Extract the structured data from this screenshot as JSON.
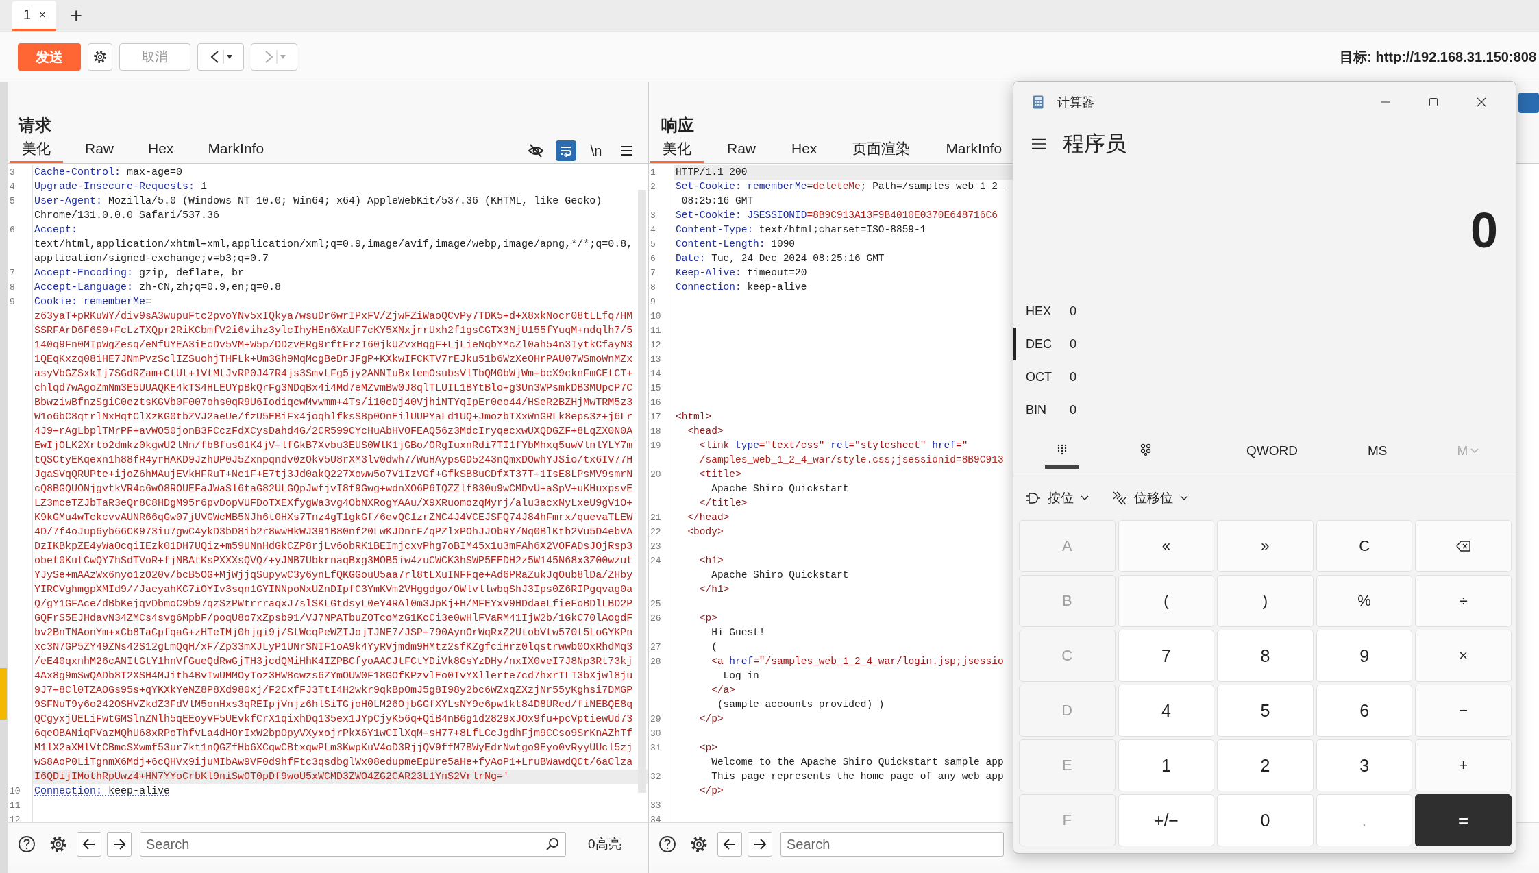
{
  "tabs": [
    {
      "label": "1",
      "close": "×",
      "selected": true
    }
  ],
  "new_tab": "+",
  "toolbar": {
    "send": "发送",
    "cancel": "取消",
    "cancel_disabled": true,
    "back_disabled": false,
    "forward_disabled": true
  },
  "target": {
    "label": "目标:",
    "url": "http://192.168.31.150:808"
  },
  "request": {
    "title": "请求",
    "tabs": [
      {
        "label": "美化",
        "selected": true
      },
      {
        "label": "Raw",
        "selected": false
      },
      {
        "label": "Hex",
        "selected": false
      },
      {
        "label": "MarkInfo",
        "selected": false
      }
    ],
    "tools": [
      {
        "kind": "hide",
        "selected": false
      },
      {
        "kind": "wrap",
        "selected": true
      },
      {
        "kind": "newline",
        "label": "\\n",
        "selected": false
      },
      {
        "kind": "menu",
        "selected": false
      }
    ],
    "lines": [
      {
        "number": "3",
        "current": false,
        "rows": [
          [
            {
              "kind": "key",
              "text": "Cache-Control:"
            },
            {
              "kind": "plain",
              "text": " max-age=0"
            }
          ]
        ]
      },
      {
        "number": "4",
        "current": false,
        "rows": [
          [
            {
              "kind": "key",
              "text": "Upgrade-Insecure-Requests:"
            },
            {
              "kind": "plain",
              "text": " 1"
            }
          ]
        ]
      },
      {
        "number": "5",
        "current": false,
        "rows": [
          [
            {
              "kind": "key",
              "text": "User-Agent:"
            },
            {
              "kind": "plain",
              "text": " Mozilla/5.0 (Windows NT 10.0; Win64; x64) AppleWebKit/537.36 (KHTML, like Gecko)"
            }
          ],
          [
            {
              "kind": "plain",
              "text": "Chrome/131.0.0.0 Safari/537.36"
            }
          ]
        ]
      },
      {
        "number": "6",
        "current": false,
        "rows": [
          [
            {
              "kind": "key",
              "text": "Accept:"
            }
          ],
          [
            {
              "kind": "plain",
              "text": "text/html,application/xhtml+xml,application/xml;q=0.9,image/avif,image/webp,image/apng,*/*;q=0.8,"
            }
          ],
          [
            {
              "kind": "plain",
              "text": "application/signed-exchange;v=b3;q=0.7"
            }
          ]
        ]
      },
      {
        "number": "7",
        "current": false,
        "rows": [
          [
            {
              "kind": "key",
              "text": "Accept-Encoding:"
            },
            {
              "kind": "plain",
              "text": " gzip, deflate, br"
            }
          ]
        ]
      },
      {
        "number": "8",
        "current": false,
        "rows": [
          [
            {
              "kind": "key",
              "text": "Accept-Language:"
            },
            {
              "kind": "plain",
              "text": " zh-CN,zh;q=0.9,en;q=0.8"
            }
          ]
        ]
      },
      {
        "number": "9",
        "current": true,
        "rows": [
          [
            {
              "kind": "key",
              "text": "Cookie:"
            },
            {
              "kind": "attr",
              "text": " rememberMe"
            },
            {
              "kind": "plain",
              "text": "="
            }
          ],
          [
            {
              "kind": "value",
              "text": "z63yaT+pRKuWY/div9sA3wupuFtc2pvoYNv5xIQkya7wsuDr6wrIPxFV/ZjwFZiWaoQCvPy7TDK5+d+X8xkNocr08tLLfq7HM"
            }
          ],
          [
            {
              "kind": "value",
              "text": "SSRFArD6F6S0+FcLzTXQpr2RiKCbmfV2i6vihz3ylcIhyHEn6XaUF7cKY5XNxjrrUxh2f1gsCGTX3NjU155fYuqM+ndqlh7/5"
            }
          ],
          [
            {
              "kind": "value",
              "text": "140q9Fn0MIpWgZesq/eNfUYEA3iEcDv5VM+W5p/DDzvERg9rftFrzI60jkUZvxHqgF+LjLieNqbYMcZl0ah54n3IytkCfayN3"
            }
          ],
          [
            {
              "kind": "value",
              "text": "1QEqKxzq08iHE7JNmPvzSclIZSuohjTHFLk+Um3Gh9MqMcgBeDrJFgP+KXkwIFCKTV7rEJku51b6WzXeOHrPAU07WSmoWnMZx"
            }
          ],
          [
            {
              "kind": "value",
              "text": "asyVbGZSxkIj7SGdRZam+CtUt+1VtMtJvRP0J47R4js3SmvLFg5jy2ANNIuBxlemOsubsVlTbQM0bWjWm+bcX9cknFmCEtCT+"
            }
          ],
          [
            {
              "kind": "value",
              "text": "chlqd7wAgoZmNm3E5UUAQKE4kTS4HLEUYpBkQrFg3NDqBx4i4Md7eMZvmBw0J8qlTLUIL1BYtBlo+g3Un3WPsmkDB3MUpcP7C"
            }
          ],
          [
            {
              "kind": "value",
              "text": "BbwziwBfnzSgiC0eztsKGVb0F007ohs0qR9U6IodiqcwMvwmm+4Ts/i10cDj40VjhiNTYqIpEr0eo44/HSeR2BZHjMwTRM5z3"
            }
          ],
          [
            {
              "kind": "value",
              "text": "W1o6bC8qtrlNxHqtClXzKG0tbZVJ2aeUe/fzU5EBiFx4joqhlfksS8p0OnEilUUPYaLd1UQ+JmozbIXxWnGRLk8eps3z+j6Lr"
            }
          ],
          [
            {
              "kind": "value",
              "text": "4J9+rAgLbplTMrPF+avWO50jonB3FCczFdXCysDahd4G/2CR599CYcHuAbHVOFEAQ56z3MdcIryqecxwUXQDGZF+8LqZX0N0A"
            }
          ],
          [
            {
              "kind": "value",
              "text": "EwIjOLK2Xrto2dmkz0kgwU2lNn/fb8fus01K4jV+lfGkB7Xvbu3EUS0WlK1jGBo/ORgIuxnRdi7TI1fYbMhxq5uwVlnlYLY7m"
            }
          ],
          [
            {
              "kind": "value",
              "text": "tQSCtyEKqexn1h88fR4yrHAKD9JzhUP0J5Zxnpqndv0zOkV5U8rXM3lv0dwh7/WuHAypsGD5243nQmxDOwhYJSio/tx6IV77H"
            }
          ],
          [
            {
              "kind": "value",
              "text": "JgaSVqQRUPte+ijoZ6hMAujEVkHFRuT+Nc1F+E7tj3Jd0akQ227Xoww5o7V1IzVGf+GfkSB8uCDfXT37T+1IsE8LPsMV9smrN"
            }
          ],
          [
            {
              "kind": "value",
              "text": "cQ8BGQUONjgvtkVR4c6wO8ROUEFaJWaSl6taG82ULGQpJwfjvI8f9Gwg+wdnXO6P6IQZZlf830u9wCMDvU+aSpV+uKHuxpsvE"
            }
          ],
          [
            {
              "kind": "value",
              "text": "LZ3mceTZJbTaR3eQr8C8HDgM95r6pvDopVUFDoTXEXfygWa3vg4ObNXRogYAAu/X9XRuomozqMyrj/alu3acxNyLxeU9gV1O+"
            }
          ],
          [
            {
              "kind": "value",
              "text": "K9kGMu4wTckcvvAUNR66qGw07jUVGWcMB5NJh6t0HXs7Tnz4gT1gkGf/6evQC1zrZNC4J4VCEJSFQ74J84hFmrx/quevaTLEW"
            }
          ],
          [
            {
              "kind": "value",
              "text": "4D/7f4oJup6yb66CK973iu7gwC4ykD3bD8ib2r8wwHkWJ391B80nf20LwKJDnrF/qPZlxPOhJJObRY/Nq0BlKtb2Vu5D4ebVA"
            }
          ],
          [
            {
              "kind": "value",
              "text": "DzIKBkpZE4yWaOcqiIEzk01DH7UQiz+m59UNnHdGkCZP8rjLv6obRK1BEImjcxvPhg7oBIM45x1u3mFAh6X2VOFADsJOjRsp3"
            }
          ],
          [
            {
              "kind": "value",
              "text": "obet0KutCwQY7hSdTVoR+fjNBAtKsPXXXsQVQ/+yJNB7UbkrnaqBxg3MOB5iw4zuCWCK3hSWP5EEDH2z5W145N68x3Z00wzut"
            }
          ],
          [
            {
              "kind": "value",
              "text": "YJySe+mAAzWx6nyo1zO20v/bcB5OG+MjWjjqSupywC3y6ynLfQKGGouU5aa7rl8tLXuINFFqe+Ad6PRaZukJqOub8lDa/ZHby"
            }
          ],
          [
            {
              "kind": "value",
              "text": "YIRCVghmgpXMId9//JaeyahKC7iOYIv3sqn1GYINNpoNxUZnDIpfC3YmKVm2VHggdgo/OWlvllwbqShJ3Ips0Z6RIPgqvag0a"
            }
          ],
          [
            {
              "kind": "value",
              "text": "Q/gY1GFAce/dBbKejqvDbmoC9b97qzSzPWtrrraqxJ7slSKLGtdsyL0eY4RAl0m3JpKj+H/MFEYxV9HDdaeLfieFoBDlLBD2P"
            }
          ],
          [
            {
              "kind": "value",
              "text": "GQFrS5EJHdavN34ZMCs4svg6MpbF/poqU8o7xZpsb91/VJ7NPATbuZOTcoMzG1KcCi3e0wHlFVaRM41IjW2b/1GkC70lAogdF"
            }
          ],
          [
            {
              "kind": "value",
              "text": "bv2BnTNAonYm+xCb8TaCpfqaG+zHTeIMj0hjgi9j/StWcqPeWZIJojTJNE7/JSP+790AynOrWqRxZ2UtobVtw570t5LoGYKPn"
            }
          ],
          [
            {
              "kind": "value",
              "text": "xc3N7GP5ZY49ZNs42S12gLmQqH/xF/Zp33mXJLyP1UNrSNIF1oA9k4YyRVjmdm9HMtz2sfKZgfciHrz0lqstrwwb0OxRhdMq3"
            }
          ],
          [
            {
              "kind": "value",
              "text": "/eE40qxnhM26cANItGtY1hnVfGueQdRwGjTH3jcdQMiHhK4IZPBCfyoAACJtFCtYDiVk8GsYzDHy/nxIX0veI7J8Np3Rt73kj"
            }
          ],
          [
            {
              "kind": "value",
              "text": "4Ax8g9mSwQADb8T2XSH4MJith4BvIwUMMOyToz3HW8cwzs6ZYmOUW0F18GOfKPzvlEo0IvYXllerte7cd7hxrTLI3bXjwl8ju"
            }
          ],
          [
            {
              "kind": "value",
              "text": "9J7+8Cl0TZAOGs95s+qYKXkYeNZ8P8Xd980xj/F2CxfFJ3TtI4H2wkr9qkBpOmJ5g8I98y2bc6WZxqZXzjNr55yKghsi7DMGP"
            }
          ],
          [
            {
              "kind": "value",
              "text": "9SFNuT9y6o242OSHVZkdZ3FdVlM5onHxs3qREIpjVnjz6hlSiTGjoH0LM26OjbGGfXYLsNY9e6pw1kt84D8URed/fiNEBQE8q"
            }
          ],
          [
            {
              "kind": "value",
              "text": "QCgyxjUELiFwtGMSlnZNlh5qEEoyVF5UEvkfCrX1qixhDq135ex1JYpCjyK56q+QiB4nB6g1d2829xJOx9fu+pcVptiewUd73"
            }
          ],
          [
            {
              "kind": "value",
              "text": "6qeOBANiqPVazMQhU68xRPoThfvLa4dHOrIxW2bpOpyVXyxojrPkX6Y1wCIlXqM+sH77+8LfLCcJgdhFjm9CCso9SrKnAZhTf"
            }
          ],
          [
            {
              "kind": "value",
              "text": "M1lX2aXMlVtCBmcSXwmf53ur7kt1nQGZfHb6XCqwCBtxqwPLm3KwpKuV4oD3RjjQV9ffM7BWyEdrNwtgo9Eyo0vRyyUUcl5zj"
            }
          ],
          [
            {
              "kind": "value",
              "text": "wS8AoP0LiTgnmX6Mdj+6cQHVx9ijuMIbAw9VF0d9hfFtc3qsdbglWx08edupmeEpUre5aHe+fyAoP1+LruBWawdQCt/6aClza"
            }
          ],
          [
            {
              "kind": "value",
              "text": "I6QDijIMothRpUwz4+HN7YYoCrbKl9niSwOT0pDf9woU5xWCMD3ZWO4ZG2CAR23L1YnS2VrlrNg='"
            }
          ]
        ]
      },
      {
        "number": "10",
        "current": false,
        "rows": [
          [
            {
              "kind": "key_flagged",
              "text": "Connection:"
            },
            {
              "kind": "plain_flagged",
              "text": " keep-alive"
            }
          ]
        ]
      },
      {
        "number": "11",
        "current": false
      },
      {
        "number": "12",
        "current": false
      }
    ],
    "search": {
      "placeholder": "Search"
    },
    "highlights": "0高亮"
  },
  "response": {
    "title": "响应",
    "tabs": [
      {
        "label": "美化",
        "selected": true
      },
      {
        "label": "Raw",
        "selected": false
      },
      {
        "label": "Hex",
        "selected": false
      },
      {
        "label": "页面渲染",
        "selected": false
      },
      {
        "label": "MarkInfo",
        "selected": false
      }
    ],
    "lines": [
      {
        "number": "1",
        "current": true,
        "rows": [
          [
            {
              "kind": "plain",
              "text": "HTTP/1.1 200"
            }
          ]
        ]
      },
      {
        "number": "2",
        "current": false,
        "rows": [
          [
            {
              "kind": "key",
              "text": "Set-Cookie:"
            },
            {
              "kind": "attr",
              "text": " rememberMe"
            },
            {
              "kind": "plain",
              "text": "="
            },
            {
              "kind": "value",
              "text": "deleteMe"
            },
            {
              "kind": "plain",
              "text": "; Path=/samples_web_1_2_"
            }
          ],
          [
            {
              "kind": "plain",
              "text": " 08:25:16 GMT"
            }
          ]
        ]
      },
      {
        "number": "3",
        "current": false,
        "rows": [
          [
            {
              "kind": "key",
              "text": "Set-Cookie:"
            },
            {
              "kind": "attr",
              "text": " JSESSIONID"
            },
            {
              "kind": "value",
              "text": "=8B9C913A13F9B4010E0370E648716C6"
            }
          ]
        ]
      },
      {
        "number": "4",
        "current": false,
        "rows": [
          [
            {
              "kind": "key",
              "text": "Content-Type:"
            },
            {
              "kind": "plain",
              "text": " text/html;charset=ISO-8859-1"
            }
          ]
        ]
      },
      {
        "number": "5",
        "current": false,
        "rows": [
          [
            {
              "kind": "key",
              "text": "Content-Length:"
            },
            {
              "kind": "plain",
              "text": " 1090"
            }
          ]
        ]
      },
      {
        "number": "6",
        "current": false,
        "rows": [
          [
            {
              "kind": "key",
              "text": "Date:"
            },
            {
              "kind": "plain",
              "text": " Tue, 24 Dec 2024 08:25:16 GMT"
            }
          ]
        ]
      },
      {
        "number": "7",
        "current": false,
        "rows": [
          [
            {
              "kind": "key",
              "text": "Keep-Alive:"
            },
            {
              "kind": "plain",
              "text": " timeout=20"
            }
          ]
        ]
      },
      {
        "number": "8",
        "current": false,
        "rows": [
          [
            {
              "kind": "key",
              "text": "Connection:"
            },
            {
              "kind": "plain",
              "text": " keep-alive"
            }
          ]
        ]
      },
      {
        "number": "9",
        "current": false
      },
      {
        "number": "10",
        "current": false
      },
      {
        "number": "11",
        "current": false
      },
      {
        "number": "12",
        "current": false
      },
      {
        "number": "13",
        "current": false
      },
      {
        "number": "14",
        "current": false
      },
      {
        "number": "15",
        "current": false
      },
      {
        "number": "16",
        "current": false
      },
      {
        "number": "17",
        "current": false,
        "rows": [
          [
            {
              "kind": "tag",
              "text": "<html>"
            }
          ]
        ]
      },
      {
        "number": "18",
        "current": false,
        "rows": [
          [
            {
              "kind": "tag",
              "text": "  <head>"
            }
          ]
        ]
      },
      {
        "number": "19",
        "current": false,
        "rows": [
          [
            {
              "kind": "tag",
              "text": "    <link"
            },
            {
              "kind": "attr",
              "text": " type"
            },
            {
              "kind": "str",
              "text": "=\"text/css\""
            },
            {
              "kind": "attr",
              "text": " rel"
            },
            {
              "kind": "str",
              "text": "=\"stylesheet\""
            },
            {
              "kind": "attr",
              "text": " href"
            },
            {
              "kind": "str",
              "text": "=\""
            }
          ],
          [
            {
              "kind": "value",
              "text": "    /samples_web_1_2_4_war/style.css;jsessionid=8B9C913"
            }
          ]
        ]
      },
      {
        "number": "20",
        "current": false,
        "rows": [
          [
            {
              "kind": "tag",
              "text": "    <title>"
            }
          ],
          [
            {
              "kind": "plain",
              "text": "      Apache Shiro Quickstart"
            }
          ],
          [
            {
              "kind": "tag",
              "text": "    </title>"
            }
          ]
        ]
      },
      {
        "number": "21",
        "current": false,
        "rows": [
          [
            {
              "kind": "tag",
              "text": "  </head>"
            }
          ]
        ]
      },
      {
        "number": "22",
        "current": false,
        "rows": [
          [
            {
              "kind": "tag",
              "text": "  <body>"
            }
          ]
        ]
      },
      {
        "number": "23",
        "current": false
      },
      {
        "number": "24",
        "current": false,
        "rows": [
          [
            {
              "kind": "tag",
              "text": "    <h1>"
            }
          ],
          [
            {
              "kind": "plain",
              "text": "      Apache Shiro Quickstart"
            }
          ],
          [
            {
              "kind": "tag",
              "text": "    </h1>"
            }
          ]
        ]
      },
      {
        "number": "25",
        "current": false
      },
      {
        "number": "26",
        "current": false,
        "rows": [
          [
            {
              "kind": "tag",
              "text": "    <p>"
            }
          ],
          [
            {
              "kind": "plain",
              "text": "      Hi Guest!"
            }
          ]
        ]
      },
      {
        "number": "27",
        "current": false,
        "rows": [
          [
            {
              "kind": "plain",
              "text": "      ("
            }
          ]
        ]
      },
      {
        "number": "28",
        "current": false,
        "rows": [
          [
            {
              "kind": "tag",
              "text": "      <a"
            },
            {
              "kind": "attr",
              "text": " href"
            },
            {
              "kind": "str",
              "text": "=\"/samples_web_1_2_4_war/login.jsp;jsessio"
            }
          ],
          [
            {
              "kind": "plain",
              "text": "        Log in"
            }
          ],
          [
            {
              "kind": "tag",
              "text": "      </a>"
            }
          ],
          [
            {
              "kind": "plain",
              "text": "       (sample accounts provided) )"
            }
          ]
        ]
      },
      {
        "number": "29",
        "current": false,
        "rows": [
          [
            {
              "kind": "tag",
              "text": "    </p>"
            }
          ]
        ]
      },
      {
        "number": "30",
        "current": false
      },
      {
        "number": "31",
        "current": false,
        "rows": [
          [
            {
              "kind": "tag",
              "text": "    <p>"
            }
          ],
          [
            {
              "kind": "plain",
              "text": "      Welcome to the Apache Shiro Quickstart sample app"
            }
          ]
        ]
      },
      {
        "number": "32",
        "current": false,
        "rows": [
          [
            {
              "kind": "plain",
              "text": "      This page represents the home page of any web app"
            }
          ],
          [
            {
              "kind": "tag",
              "text": "    </p>"
            }
          ]
        ]
      },
      {
        "number": "33",
        "current": false
      },
      {
        "number": "34",
        "current": false
      }
    ],
    "search": {
      "placeholder": "Search"
    }
  },
  "calculator": {
    "title": "计算器",
    "mode": "程序员",
    "display": "0",
    "bases": [
      {
        "label": "HEX",
        "value": "0",
        "selected": false
      },
      {
        "label": "DEC",
        "value": "0",
        "selected": true
      },
      {
        "label": "OCT",
        "value": "0",
        "selected": false
      },
      {
        "label": "BIN",
        "value": "0",
        "selected": false
      }
    ],
    "views": [
      {
        "kind": "keypad",
        "selected": true
      },
      {
        "kind": "bits",
        "selected": false
      }
    ],
    "word": "QWORD",
    "memory_store": "MS",
    "memory_list": {
      "label": "M",
      "disabled": true
    },
    "functions": [
      {
        "kind": "bitwise",
        "label": "按位"
      },
      {
        "kind": "shift",
        "label": "位移位"
      }
    ],
    "keys": [
      {
        "kind": "hex",
        "label": "A",
        "disabled": true
      },
      {
        "kind": "op",
        "label": "«",
        "disabled": false
      },
      {
        "kind": "op",
        "label": "»",
        "disabled": false
      },
      {
        "kind": "op",
        "label": "C",
        "disabled": false
      },
      {
        "kind": "backspace",
        "disabled": false
      },
      {
        "kind": "hex",
        "label": "B",
        "disabled": true
      },
      {
        "kind": "op",
        "label": "(",
        "disabled": false
      },
      {
        "kind": "op",
        "label": ")",
        "disabled": false
      },
      {
        "kind": "op",
        "label": "%",
        "disabled": false
      },
      {
        "kind": "op",
        "label": "÷",
        "disabled": false
      },
      {
        "kind": "hex",
        "label": "C",
        "disabled": true
      },
      {
        "kind": "digit",
        "label": "7",
        "disabled": false
      },
      {
        "kind": "digit",
        "label": "8",
        "disabled": false
      },
      {
        "kind": "digit",
        "label": "9",
        "disabled": false
      },
      {
        "kind": "op",
        "label": "×",
        "disabled": false
      },
      {
        "kind": "hex",
        "label": "D",
        "disabled": true
      },
      {
        "kind": "digit",
        "label": "4",
        "disabled": false
      },
      {
        "kind": "digit",
        "label": "5",
        "disabled": false
      },
      {
        "kind": "digit",
        "label": "6",
        "disabled": false
      },
      {
        "kind": "op",
        "label": "−",
        "disabled": false
      },
      {
        "kind": "hex",
        "label": "E",
        "disabled": true
      },
      {
        "kind": "digit",
        "label": "1",
        "disabled": false
      },
      {
        "kind": "digit",
        "label": "2",
        "disabled": false
      },
      {
        "kind": "digit",
        "label": "3",
        "disabled": false
      },
      {
        "kind": "op",
        "label": "+",
        "disabled": false
      },
      {
        "kind": "hex",
        "label": "F",
        "disabled": true
      },
      {
        "kind": "digit",
        "label": "+/−",
        "disabled": false
      },
      {
        "kind": "digit",
        "label": "0",
        "disabled": false
      },
      {
        "kind": "digit",
        "label": ".",
        "disabled": true
      },
      {
        "kind": "equals",
        "label": "=",
        "disabled": false
      }
    ]
  }
}
